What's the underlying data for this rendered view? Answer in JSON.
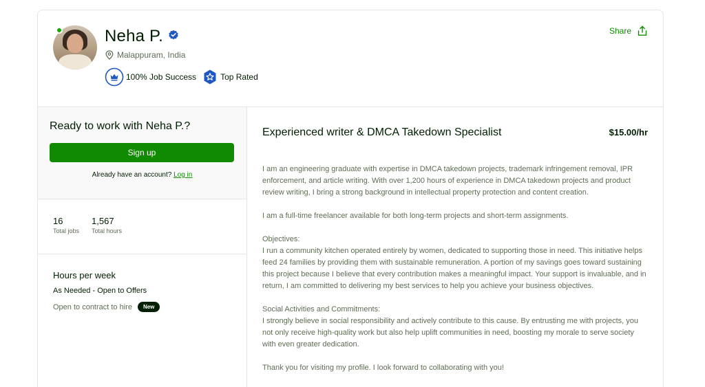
{
  "profile": {
    "name": "Neha P.",
    "location": "Malappuram, India",
    "job_success": "100% Job Success",
    "top_rated": "Top Rated",
    "share_label": "Share"
  },
  "sidebar": {
    "ready_heading": "Ready to work with Neha P.?",
    "signup_label": "Sign up",
    "already_text": "Already have an account?",
    "login_label": "Log in",
    "stats": [
      {
        "value": "16",
        "label": "Total jobs"
      },
      {
        "value": "1,567",
        "label": "Total hours"
      }
    ],
    "hours_heading": "Hours per week",
    "hours_value": "As Needed - Open to Offers",
    "contract_text": "Open to contract to hire",
    "new_badge": "New"
  },
  "main": {
    "title": "Experienced writer & DMCA Takedown Specialist",
    "rate": "$15.00/hr",
    "description": [
      "I am an engineering graduate with expertise in DMCA takedown projects, trademark infringement removal, IPR enforcement, and article writing. With over 1,200 hours of experience in DMCA takedown projects and product review writing, I bring a strong background in intellectual property protection and content creation.",
      "I am a full-time freelancer available for both long-term projects and short-term assignments.",
      "Objectives:",
      "I run a community kitchen operated entirely by women, dedicated to supporting those in need. This initiative helps feed 24 families by providing them with sustainable remuneration. A portion of my savings goes toward sustaining this project because I believe that every contribution makes a meaningful impact. Your support is invaluable, and in return, I am committed to delivering my best services to help you achieve your business objectives.",
      "Social Activities and Commitments:",
      "I strongly believe in social responsibility and actively contribute to this cause. By entrusting me with projects, you not only receive high-quality work but also help uplift communities in need, boosting my morale to serve society with even greater dedication.",
      "Thank you for visiting my profile. I look forward to collaborating with you!"
    ]
  },
  "colors": {
    "brand_green": "#108a00",
    "online_green": "#14a800",
    "verified_blue": "#1f57c3"
  }
}
